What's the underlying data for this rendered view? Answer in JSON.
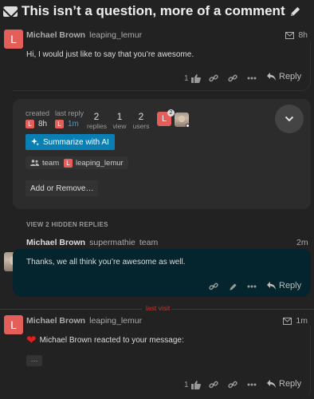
{
  "title": "This isn’t a question, more of a comment",
  "post1": {
    "avatar_letter": "L",
    "name": "Michael Brown",
    "username": "leaping_lemur",
    "time": "8h",
    "body": "Hi, I would just like to say that you’re awesome.",
    "like_count": "1",
    "reply_label": "Reply"
  },
  "topic_map": {
    "created_label": "created",
    "created_avatar": "L",
    "created_time": "8h",
    "last_reply_label": "last reply",
    "last_reply_avatar": "L",
    "last_reply_time": "1m",
    "replies_count": "2",
    "replies_label": "replies",
    "views_count": "1",
    "views_label": "view",
    "users_count": "2",
    "users_label": "users",
    "participant_badge": "2",
    "summarize_label": "Summarize with AI",
    "group_label": "team",
    "user_avatar": "L",
    "user_label": "leaping_lemur",
    "add_remove_label": "Add or Remove…"
  },
  "hidden_replies_label": "VIEW 2 HIDDEN REPLIES",
  "post2": {
    "name": "Michael Brown",
    "username": "supermathie",
    "group": "team",
    "time": "2m",
    "body": "Thanks, we all think you’re awesome as well.",
    "reply_label": "Reply"
  },
  "last_visit_label": "last visit",
  "post3": {
    "avatar_letter": "L",
    "name": "Michael Brown",
    "username": "leaping_lemur",
    "time": "1m",
    "reaction_text": "Michael Brown reacted to your message:",
    "code_chip": "···",
    "like_count": "1",
    "reply_label": "Reply"
  },
  "colors": {
    "background": "#222222",
    "avatar_red": "#e45f5a",
    "ai_button_blue": "#0a7fb4",
    "highlight_post": "#04252d",
    "last_visit_red": "#c0392b"
  },
  "icons": [
    "envelope-icon",
    "pencil-icon",
    "like-icon",
    "link-icon",
    "ellipsis-icon",
    "reply-icon",
    "chevron-down-icon",
    "sparkle-icon",
    "users-icon",
    "heart-icon"
  ]
}
